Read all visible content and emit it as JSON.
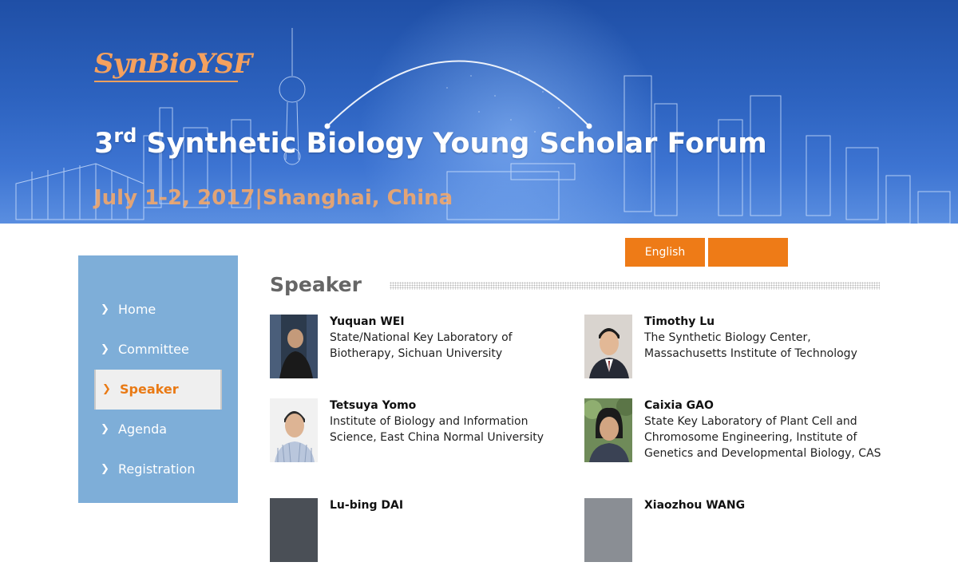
{
  "banner": {
    "logo_text": "SynBioYSF",
    "title_ordinal": "3",
    "title_sup": "rd",
    "title_rest": " Synthetic Biology Young Scholar Forum",
    "subtitle": "July 1-2, 2017|Shanghai, China"
  },
  "language": {
    "english_label": "English",
    "chinese_label": ""
  },
  "sidebar": {
    "items": [
      {
        "label": "Home",
        "active": false
      },
      {
        "label": "Committee",
        "active": false
      },
      {
        "label": "Speaker",
        "active": true
      },
      {
        "label": "Agenda",
        "active": false
      },
      {
        "label": "Registration",
        "active": false
      }
    ]
  },
  "main": {
    "section_title": "Speaker",
    "speakers": [
      {
        "name": "Yuquan WEI",
        "affiliation": "State/National Key Laboratory of Biotherapy, Sichuan University"
      },
      {
        "name": "Timothy Lu",
        "affiliation": "The Synthetic Biology Center, Massachusetts Institute of Technology"
      },
      {
        "name": "Tetsuya Yomo",
        "affiliation": "Institute of Biology and Information Science, East China Normal University"
      },
      {
        "name": "Caixia GAO",
        "affiliation": "State Key Laboratory of Plant Cell and Chromosome Engineering, Institute of Genetics and Developmental Biology, CAS"
      },
      {
        "name": "Lu-bing DAI",
        "affiliation": ""
      },
      {
        "name": "Xiaozhou WANG",
        "affiliation": ""
      }
    ]
  },
  "colors": {
    "accent_orange": "#ee7b17",
    "sidebar_blue": "#7eaed8",
    "banner_blue": "#2d63c0"
  }
}
